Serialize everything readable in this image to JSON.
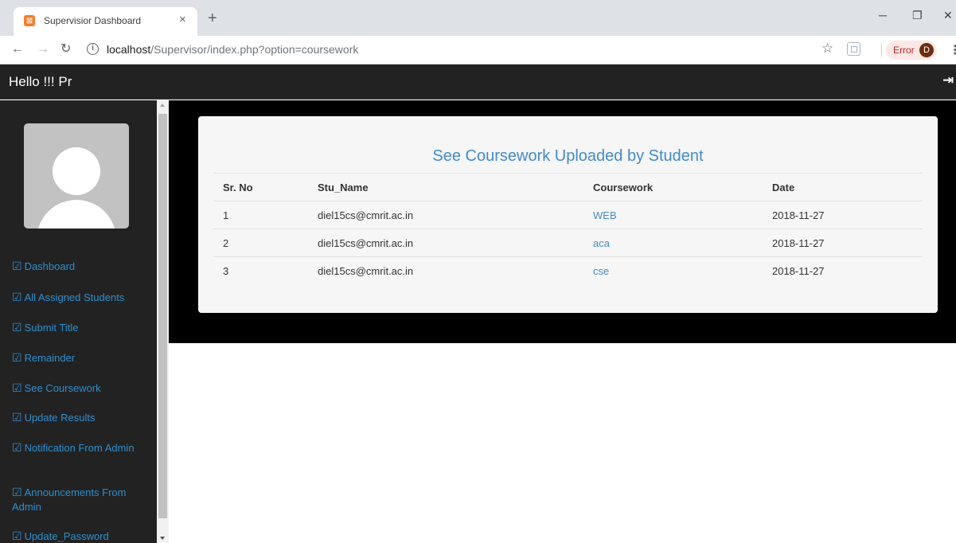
{
  "browser": {
    "tab_title": "Supervisior Dashboard",
    "favicon_text": "⛝",
    "new_tab": "+",
    "url_host": "localhost",
    "url_path": "/Supervisor/index.php?option=coursework",
    "error_label": "Error",
    "profile_initial": "D"
  },
  "navbar": {
    "brand": "Hello !!! Pr"
  },
  "sidebar": {
    "items": [
      {
        "label": "Dashboard"
      },
      {
        "label": "All Assigned Students"
      },
      {
        "label": "Submit Title"
      },
      {
        "label": "Remainder"
      },
      {
        "label": "See Coursework"
      },
      {
        "label": "Update Results"
      },
      {
        "label": "Notification From Admin"
      },
      {
        "label": "Announcements From Admin"
      },
      {
        "label": "Update_Password"
      }
    ]
  },
  "panel": {
    "title": "See Coursework Uploaded by Student",
    "columns": [
      "Sr. No",
      "Stu_Name",
      "Coursework",
      "Date"
    ],
    "rows": [
      {
        "sr": "1",
        "name": "diel15cs@cmrit.ac.in",
        "coursework": "WEB",
        "date": "2018-11-27"
      },
      {
        "sr": "2",
        "name": "diel15cs@cmrit.ac.in",
        "coursework": "aca",
        "date": "2018-11-27"
      },
      {
        "sr": "3",
        "name": "diel15cs@cmrit.ac.in",
        "coursework": "cse",
        "date": "2018-11-27"
      }
    ]
  },
  "colors": {
    "navbar_bg": "#222222",
    "link": "#2d8fcf",
    "title": "#428bca",
    "band_bg": "#000000"
  },
  "icons": {
    "sidebar_item": "edit-square-icon",
    "logout": "logout-icon"
  }
}
